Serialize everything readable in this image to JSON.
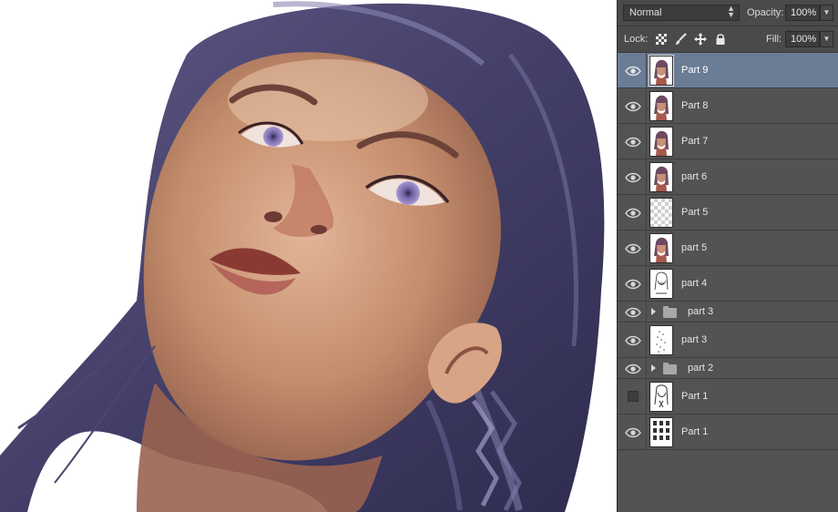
{
  "canvas": {
    "subject": "painting-portrait",
    "colors": {
      "hair": "#4a4670",
      "skin": "#c7926f",
      "lips": "#8e3d35",
      "background": "#ffffff"
    }
  },
  "panel": {
    "blend_mode": "Normal",
    "opacity_label": "Opacity:",
    "opacity_value": "100%",
    "lock_label": "Lock:",
    "fill_label": "Fill:",
    "fill_value": "100%",
    "lock_icons": [
      "lock-transparent-icon",
      "lock-paint-icon",
      "lock-move-icon",
      "lock-all-icon"
    ],
    "selection_color": "#6b7c95",
    "layers": [
      {
        "name": "Part 9",
        "kind": "layer",
        "visible": true,
        "selected": true,
        "thumb": "color"
      },
      {
        "name": "Part 8",
        "kind": "layer",
        "visible": true,
        "selected": false,
        "thumb": "color"
      },
      {
        "name": "Part 7",
        "kind": "layer",
        "visible": true,
        "selected": false,
        "thumb": "color"
      },
      {
        "name": "part 6",
        "kind": "layer",
        "visible": true,
        "selected": false,
        "thumb": "color"
      },
      {
        "name": "Part 5",
        "kind": "layer",
        "visible": true,
        "selected": false,
        "thumb": "transparent"
      },
      {
        "name": "part 5",
        "kind": "layer",
        "visible": true,
        "selected": false,
        "thumb": "color"
      },
      {
        "name": "part 4",
        "kind": "layer",
        "visible": true,
        "selected": false,
        "thumb": "sketch"
      },
      {
        "name": "part 3",
        "kind": "group",
        "visible": true,
        "selected": false
      },
      {
        "name": "part 3",
        "kind": "layer",
        "visible": true,
        "selected": false,
        "thumb": "dots"
      },
      {
        "name": "part 2",
        "kind": "group",
        "visible": true,
        "selected": false
      },
      {
        "name": "Part 1",
        "kind": "layer",
        "visible": false,
        "selected": false,
        "thumb": "sketch"
      },
      {
        "name": "Part 1",
        "kind": "layer",
        "visible": true,
        "selected": false,
        "thumb": "sheet"
      }
    ]
  }
}
